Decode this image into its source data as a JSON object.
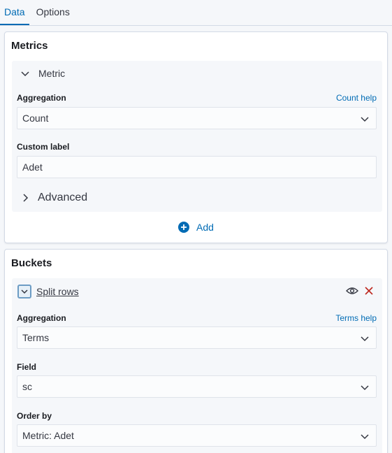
{
  "tabs": [
    {
      "label": "Data",
      "active": true
    },
    {
      "label": "Options",
      "active": false
    }
  ],
  "metrics": {
    "title": "Metrics",
    "metric": {
      "header": "Metric",
      "aggregation_label": "Aggregation",
      "aggregation_help": "Count help",
      "aggregation_value": "Count",
      "custom_label_label": "Custom label",
      "custom_label_value": "Adet",
      "advanced_label": "Advanced"
    },
    "add_label": "Add"
  },
  "buckets": {
    "title": "Buckets",
    "split": {
      "header": "Split rows",
      "aggregation_label": "Aggregation",
      "aggregation_help": "Terms help",
      "aggregation_value": "Terms",
      "field_label": "Field",
      "field_value": "sc",
      "order_by_label": "Order by",
      "order_by_value": "Metric: Adet"
    }
  },
  "colors": {
    "accent": "#006bb4",
    "danger": "#bd271e",
    "border": "#d3dae6"
  }
}
